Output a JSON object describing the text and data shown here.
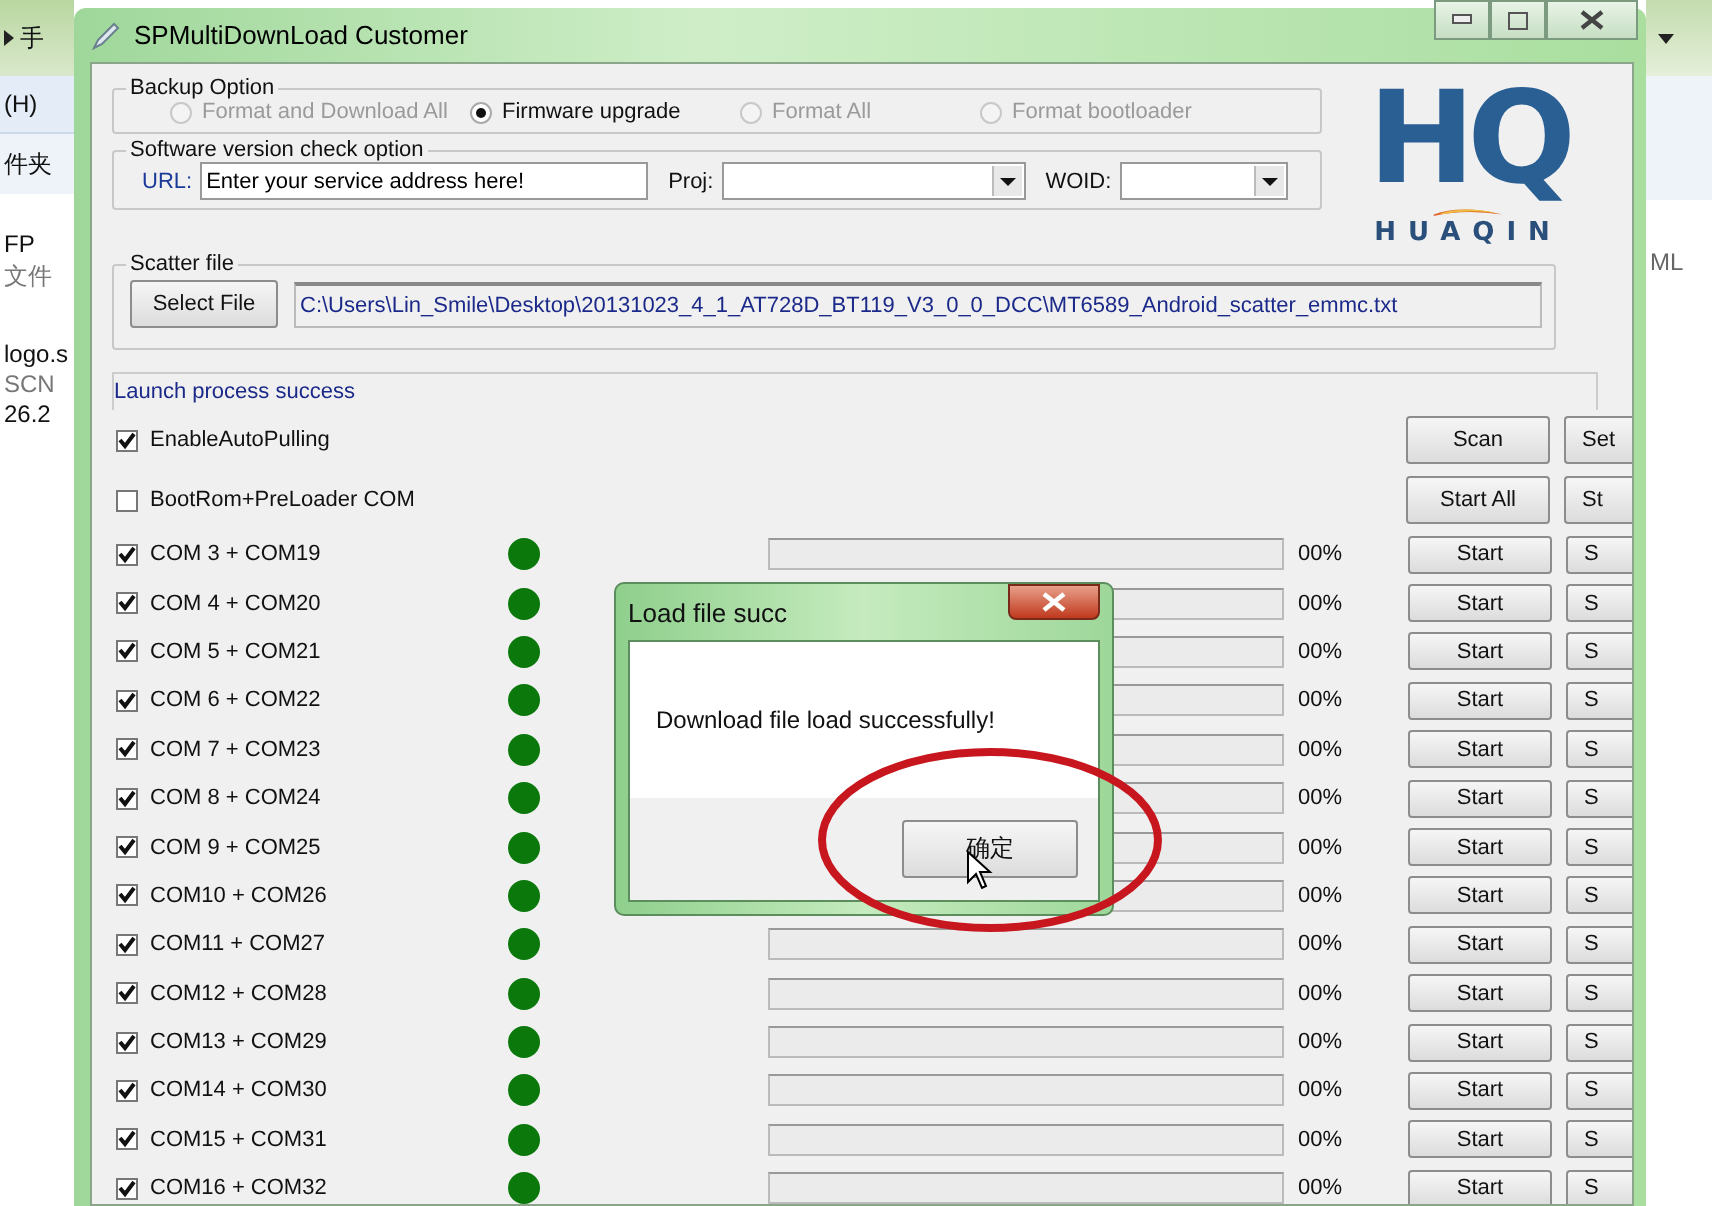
{
  "background_window": {
    "texts": [
      "手",
      "(H)",
      "件夹",
      "FP",
      "文件",
      "logo.s",
      "SCN",
      "26.2"
    ],
    "right_texts": [
      "ML"
    ]
  },
  "window": {
    "title": "SPMultiDownLoad Customer"
  },
  "backup_option": {
    "title": "Backup Option",
    "options": [
      {
        "label": "Format and Download All",
        "selected": false,
        "disabled": true
      },
      {
        "label": "Firmware upgrade",
        "selected": true,
        "disabled": false
      },
      {
        "label": "Format All",
        "selected": false,
        "disabled": true
      },
      {
        "label": "Format bootloader",
        "selected": false,
        "disabled": true
      }
    ]
  },
  "version_check": {
    "title": "Software version check option",
    "url_label": "URL:",
    "url_value": "Enter your service address here!",
    "proj_label": "Proj:",
    "woid_label": "WOID:"
  },
  "logo": {
    "mark": "HQ",
    "name": "HUAQIN"
  },
  "scatter": {
    "title": "Scatter file",
    "button": "Select File",
    "path": "C:\\Users\\Lin_Smile\\Desktop\\20131023_4_1_AT728D_BT119_V3_0_0_DCC\\MT6589_Android_scatter_emmc.txt"
  },
  "status": "Launch process success",
  "options": [
    {
      "label": "EnableAutoPulling",
      "checked": true,
      "buttons": [
        "Scan",
        "Set"
      ]
    },
    {
      "label": "BootRom+PreLoader COM",
      "checked": false,
      "buttons": [
        "Start All",
        "St"
      ]
    }
  ],
  "ports": [
    {
      "label": "COM 3 + COM19",
      "checked": true,
      "color": "#0a780a",
      "level": 0,
      "reading": "00%",
      "buttons": [
        "Start",
        "S"
      ]
    },
    {
      "label": "COM 4 + COM20",
      "checked": true,
      "color": "#0a780a",
      "level": 0,
      "reading": "00%",
      "buttons": [
        "Start",
        "S"
      ]
    },
    {
      "label": "COM 5 + COM21",
      "checked": true,
      "color": "#0a780a",
      "level": 0,
      "reading": "00%",
      "buttons": [
        "Start",
        "S"
      ]
    },
    {
      "label": "COM 6 + COM22",
      "checked": true,
      "color": "#0a780a",
      "level": 0,
      "reading": "00%",
      "buttons": [
        "Start",
        "S"
      ]
    },
    {
      "label": "COM 7 + COM23",
      "checked": true,
      "color": "#0a780a",
      "level": 0,
      "reading": "00%",
      "buttons": [
        "Start",
        "S"
      ]
    },
    {
      "label": "COM 8 + COM24",
      "checked": true,
      "color": "#0a780a",
      "level": 0,
      "reading": "00%",
      "buttons": [
        "Start",
        "S"
      ]
    },
    {
      "label": "COM 9 + COM25",
      "checked": true,
      "color": "#0a780a",
      "level": 0,
      "reading": "00%",
      "buttons": [
        "Start",
        "S"
      ]
    },
    {
      "label": "COM10 + COM26",
      "checked": true,
      "color": "#0a780a",
      "level": 0,
      "reading": "00%",
      "buttons": [
        "Start",
        "S"
      ]
    },
    {
      "label": "COM11 + COM27",
      "checked": true,
      "color": "#0a780a",
      "level": 0,
      "reading": "00%",
      "buttons": [
        "Start",
        "S"
      ]
    },
    {
      "label": "COM12 + COM28",
      "checked": true,
      "color": "#0a780a",
      "level": 0,
      "reading": "00%",
      "buttons": [
        "Start",
        "S"
      ]
    },
    {
      "label": "COM13 + COM29",
      "checked": true,
      "color": "#0a780a",
      "level": 0,
      "reading": "00%",
      "buttons": [
        "Start",
        "S"
      ]
    },
    {
      "label": "COM14 + COM30",
      "checked": true,
      "color": "#0a780a",
      "level": 0,
      "reading": "00%",
      "buttons": [
        "Start",
        "S"
      ]
    },
    {
      "label": "COM15 + COM31",
      "checked": true,
      "color": "#0a780a",
      "level": 0,
      "reading": "00%",
      "buttons": [
        "Start",
        "S"
      ]
    },
    {
      "label": "COM16 + COM32",
      "checked": true,
      "color": "#0a780a",
      "level": 0,
      "reading": "00%",
      "buttons": [
        "Start",
        "S"
      ]
    }
  ],
  "dialog": {
    "title": "Load file succ",
    "message": "Download file load successfully!",
    "button": "确定"
  }
}
